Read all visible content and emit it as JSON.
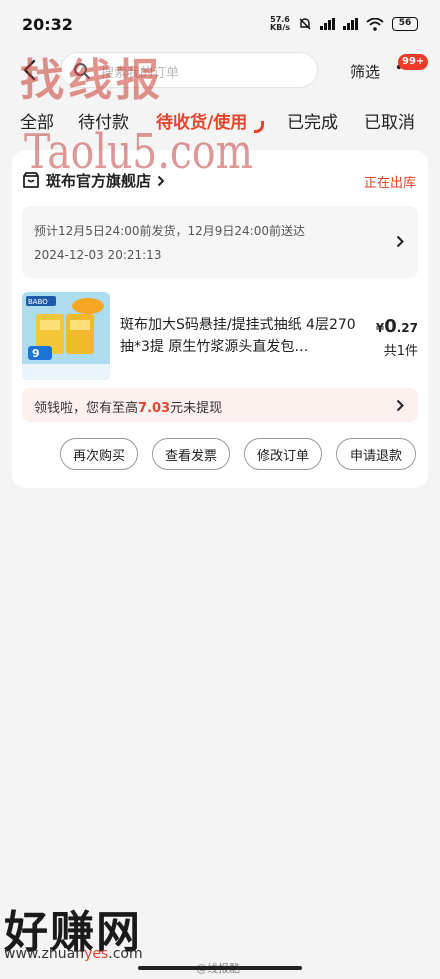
{
  "status_bar": {
    "time": "20:32",
    "net_speed_value": "57.6",
    "net_speed_unit": "KB/s",
    "battery": "56"
  },
  "header": {
    "search_placeholder": "搜索我的订单",
    "filter_label": "筛选",
    "badge": "99+"
  },
  "tabs": [
    {
      "label": "全部"
    },
    {
      "label": "待付款"
    },
    {
      "label": "待收货/使用",
      "active": true
    },
    {
      "label": "已完成"
    },
    {
      "label": "已取消"
    }
  ],
  "order": {
    "shop_name": "斑布官方旗舰店",
    "status": "正在出库",
    "delivery_estimate": "预计12月5日24:00前发货，12月9日24:00前送达",
    "order_time": "2024-12-03 20:21:13",
    "product_title": "斑布加大S码悬挂/提挂式抽纸 4层270抽*3提 原生竹浆源头直发包…",
    "price_currency": "¥",
    "price_int": "0",
    "price_dec": ".27",
    "quantity": "共1件",
    "promo_prefix": "领钱啦，您有至高",
    "promo_amount": "7.03",
    "promo_suffix": "元未提现",
    "product_brand_tag": "BABO",
    "product_count_tag": "9"
  },
  "actions": {
    "buy_again": "再次购买",
    "view_invoice": "查看发票",
    "modify_order": "修改订单",
    "request_refund": "申请退款"
  },
  "watermarks": {
    "top": "找线报",
    "latin": "Taolu5.com",
    "bottom": "好赚网",
    "url_a": "www.zhuan",
    "url_b": "yes",
    "url_c": ".com",
    "weibo": "@线报酷"
  },
  "colors": {
    "accent": "#e8432b",
    "badge": "#f03a2a",
    "background": "#f4f4f4"
  }
}
